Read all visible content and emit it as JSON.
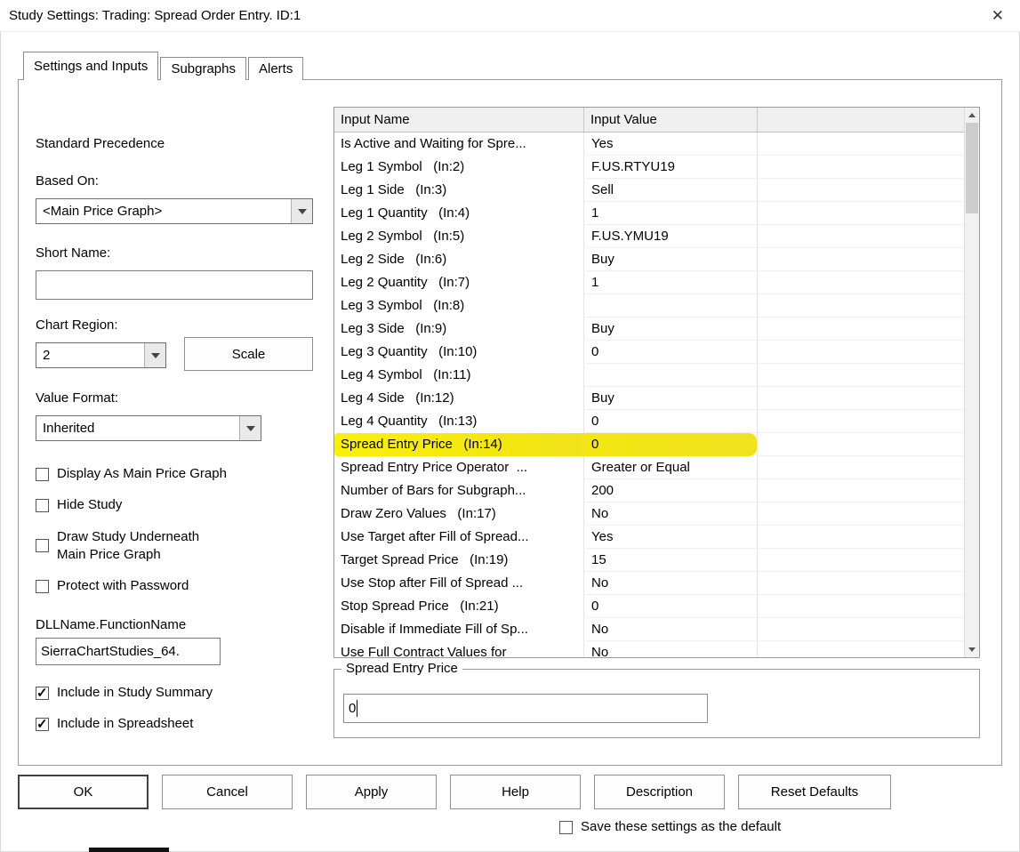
{
  "window": {
    "title": "Study Settings: Trading: Spread Order Entry. ID:1",
    "close_icon": "✕"
  },
  "tabs": [
    {
      "label": "Settings and Inputs",
      "active": true
    },
    {
      "label": "Subgraphs",
      "active": false
    },
    {
      "label": "Alerts",
      "active": false
    }
  ],
  "left_panel": {
    "precedence_text": "Standard Precedence",
    "based_on_label": "Based On:",
    "based_on_value": "<Main Price Graph>",
    "short_name_label": "Short Name:",
    "short_name_value": "",
    "chart_region_label": "Chart Region:",
    "chart_region_value": "2",
    "scale_button_label": "Scale",
    "value_format_label": "Value Format:",
    "value_format_value": "Inherited",
    "checkboxes": [
      {
        "label": "Display As Main Price Graph",
        "checked": false
      },
      {
        "label": "Hide Study",
        "checked": false
      },
      {
        "label": "Draw Study Underneath\nMain Price Graph",
        "checked": false
      },
      {
        "label": "Protect with Password",
        "checked": false
      }
    ],
    "dll_label": "DLLName.FunctionName",
    "dll_value": "SierraChartStudies_64.",
    "include_checkboxes": [
      {
        "label": "Include in Study Summary",
        "checked": true
      },
      {
        "label": "Include in Spreadsheet",
        "checked": true
      }
    ]
  },
  "inputs_table": {
    "columns": [
      "Input Name",
      "Input Value",
      ""
    ],
    "highlight_color": "#f3e611",
    "rows": [
      {
        "name": "Is Active and Waiting for Spre...",
        "value": "Yes",
        "highlight": false
      },
      {
        "name": "Leg 1 Symbol   (In:2)",
        "value": "F.US.RTYU19",
        "highlight": false
      },
      {
        "name": "Leg 1 Side   (In:3)",
        "value": "Sell",
        "highlight": false
      },
      {
        "name": "Leg 1 Quantity   (In:4)",
        "value": "1",
        "highlight": false
      },
      {
        "name": "Leg 2 Symbol   (In:5)",
        "value": "F.US.YMU19",
        "highlight": false
      },
      {
        "name": "Leg 2 Side   (In:6)",
        "value": "Buy",
        "highlight": false
      },
      {
        "name": "Leg 2 Quantity   (In:7)",
        "value": "1",
        "highlight": false
      },
      {
        "name": "Leg 3 Symbol   (In:8)",
        "value": "",
        "highlight": false
      },
      {
        "name": "Leg 3 Side   (In:9)",
        "value": "Buy",
        "highlight": false
      },
      {
        "name": "Leg 3 Quantity   (In:10)",
        "value": "0",
        "highlight": false
      },
      {
        "name": "Leg 4 Symbol   (In:11)",
        "value": "",
        "highlight": false
      },
      {
        "name": "Leg 4 Side   (In:12)",
        "value": "Buy",
        "highlight": false
      },
      {
        "name": "Leg 4 Quantity   (In:13)",
        "value": "0",
        "highlight": false
      },
      {
        "name": "Spread Entry Price   (In:14)",
        "value": "0",
        "highlight": true
      },
      {
        "name": "Spread Entry Price Operator  ...",
        "value": "Greater or Equal",
        "highlight": false
      },
      {
        "name": "Number of Bars for Subgraph...",
        "value": "200",
        "highlight": false
      },
      {
        "name": "Draw Zero Values   (In:17)",
        "value": "No",
        "highlight": false
      },
      {
        "name": "Use Target after Fill of Spread...",
        "value": "Yes",
        "highlight": false
      },
      {
        "name": "Target Spread Price   (In:19)",
        "value": "15",
        "highlight": false
      },
      {
        "name": "Use Stop after Fill of Spread ...",
        "value": "No",
        "highlight": false
      },
      {
        "name": "Stop Spread Price   (In:21)",
        "value": "0",
        "highlight": false
      },
      {
        "name": "Disable if Immediate Fill of Sp...",
        "value": "No",
        "highlight": false
      },
      {
        "name": "Use Full Contract Values for",
        "value": "No",
        "highlight": false
      }
    ]
  },
  "entry_group": {
    "title": "Spread Entry Price",
    "value": "0"
  },
  "buttons": [
    "OK",
    "Cancel",
    "Apply",
    "Help",
    "Description",
    "Reset Defaults"
  ],
  "save_default": {
    "label": "Save these settings as the default",
    "checked": false
  }
}
